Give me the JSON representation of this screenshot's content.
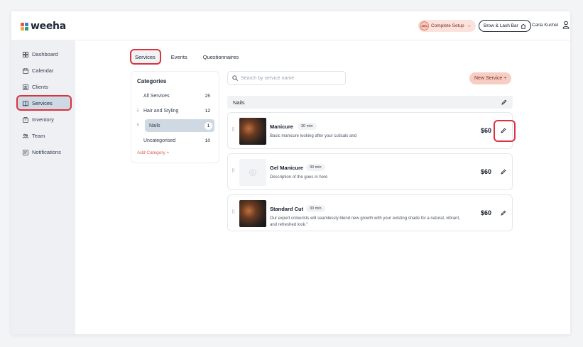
{
  "app": {
    "brand": "weeha",
    "brand_colors": [
      "#e4574a",
      "#3b82c4",
      "#f2a93b",
      "#2e9e6a"
    ]
  },
  "header": {
    "setup_progress": "25%",
    "setup_label": "Complete Setup",
    "location_label": "Brow & Lash Bar",
    "user_name": "Carla Kuchel"
  },
  "sidebar": {
    "items": [
      {
        "label": "Dashboard",
        "icon": "grid-icon"
      },
      {
        "label": "Calendar",
        "icon": "calendar-icon"
      },
      {
        "label": "Clients",
        "icon": "contact-icon"
      },
      {
        "label": "Services",
        "icon": "book-icon",
        "active": true
      },
      {
        "label": "Inventory",
        "icon": "box-icon"
      },
      {
        "label": "Team",
        "icon": "team-icon"
      },
      {
        "label": "Notifications",
        "icon": "notification-icon"
      }
    ]
  },
  "tabs": [
    {
      "label": "Services",
      "active": true
    },
    {
      "label": "Events"
    },
    {
      "label": "Questionnaires"
    }
  ],
  "categories": {
    "title": "Categories",
    "items": [
      {
        "name": "All Services",
        "count": "25"
      },
      {
        "name": "Hair and Styling",
        "count": "12"
      },
      {
        "name": "Nails",
        "count": "1",
        "active": true
      },
      {
        "name": "Uncategorised",
        "count": "10"
      }
    ],
    "add_label": "Add Category +"
  },
  "search": {
    "placeholder": "Search by service name"
  },
  "new_service_label": "New Service +",
  "group": {
    "name": "Nails"
  },
  "services": [
    {
      "name": "Manicure",
      "duration": "30 min",
      "description": "Basic manicure looking after your cuticals and",
      "price": "$60",
      "thumbnail": "photo"
    },
    {
      "name": "Gel Manicure",
      "duration": "30 min",
      "description": "Description of the  goes in here",
      "price": "$60",
      "thumbnail": "placeholder"
    },
    {
      "name": "Standard Cut",
      "duration": "30 min",
      "description": "Our expert colourists will seamlessly blend new growth with your existing shade for a natural, vibrant, and refreshed look.\"",
      "price": "$60",
      "thumbnail": "photo"
    }
  ],
  "colors": {
    "accent": "#e0614d",
    "highlight_ring": "#d8343f",
    "active_bg": "#cfd9e3"
  }
}
